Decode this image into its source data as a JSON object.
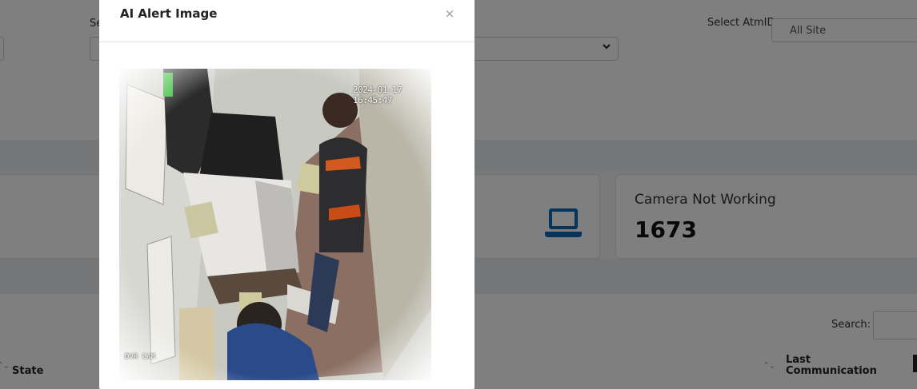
{
  "filters": {
    "select_label_left": "Se",
    "atm_label": "Select AtmID",
    "atm_value": "All Site"
  },
  "cards": [
    {
      "title": "Camera Not Working",
      "value": "1673"
    }
  ],
  "table": {
    "search_label": "Search:",
    "headers": [
      "State",
      "Last Communication"
    ]
  },
  "modal": {
    "title": "AI Alert Image",
    "close": "×",
    "image": {
      "timestamp": "2024-01-17 16:45:47",
      "camera_label": "DVR CAM"
    }
  },
  "colors": {
    "accent_blue": "#0a6bb8",
    "backdrop": "rgba(0,0,0,0.5)"
  }
}
